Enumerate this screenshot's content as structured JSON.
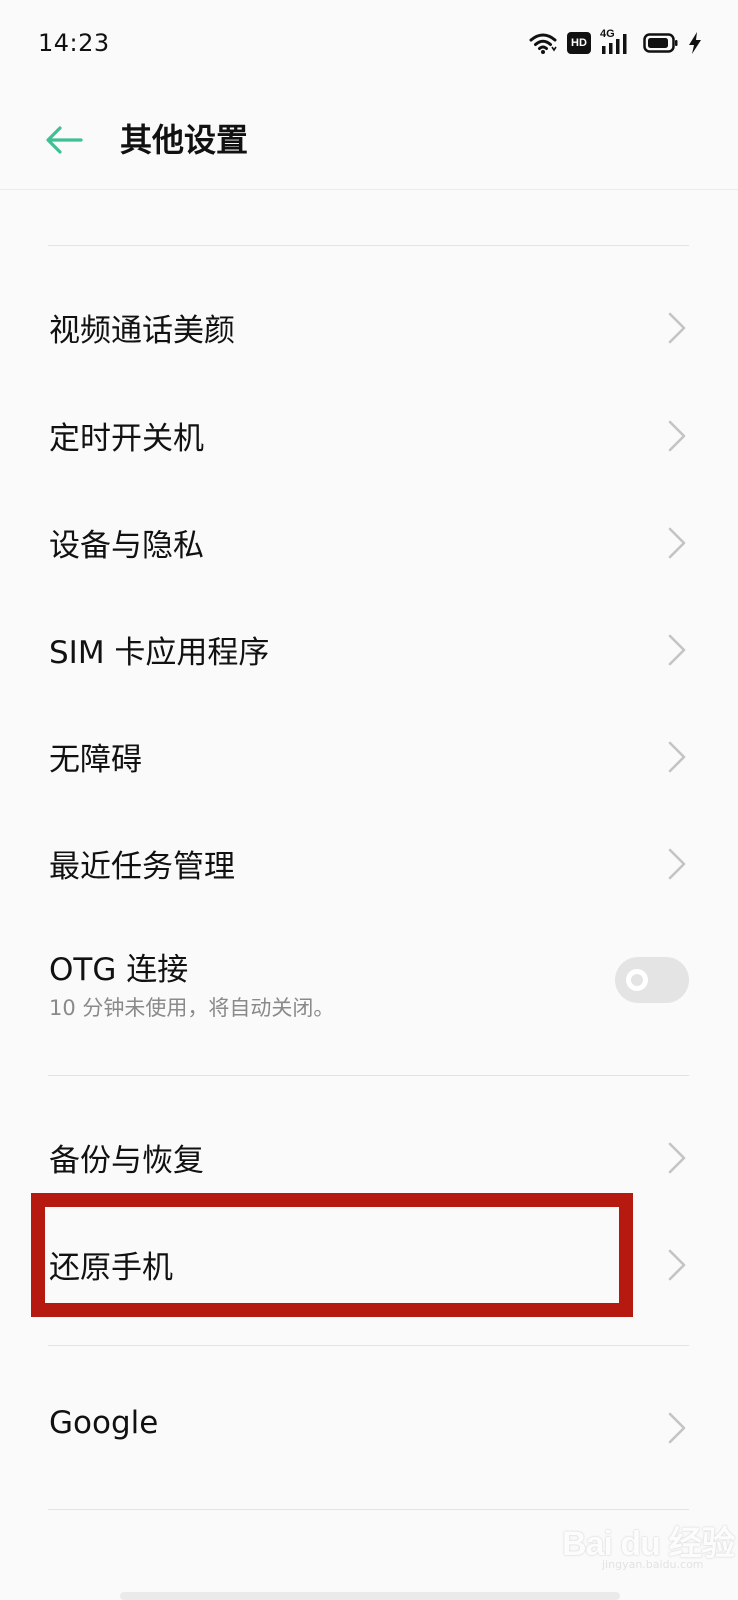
{
  "status_bar": {
    "time": "14:23",
    "network_label": "4G",
    "hd_label": "HD",
    "icons": [
      "wifi-icon",
      "hd-icon",
      "signal-icon",
      "battery-icon",
      "charging-icon"
    ]
  },
  "header": {
    "title": "其他设置",
    "back_icon": "arrow-left-icon",
    "accent_color": "#3fbf93"
  },
  "items": [
    {
      "label": "视频通话美颜",
      "type": "chevron"
    },
    {
      "label": "定时开关机",
      "type": "chevron"
    },
    {
      "label": "设备与隐私",
      "type": "chevron"
    },
    {
      "label": "SIM 卡应用程序",
      "type": "chevron"
    },
    {
      "label": "无障碍",
      "type": "chevron"
    },
    {
      "label": "最近任务管理",
      "type": "chevron"
    },
    {
      "label": "OTG 连接",
      "subtitle": "10 分钟未使用，将自动关闭。",
      "type": "toggle",
      "enabled": false
    },
    {
      "label": "备份与恢复",
      "type": "chevron"
    },
    {
      "label": "还原手机",
      "type": "chevron",
      "highlighted": true
    },
    {
      "label": "Google",
      "type": "chevron"
    }
  ],
  "highlight_color": "#b51910",
  "watermark": {
    "text": "Bai du 经验",
    "sub": "jingyan.baidu.com"
  }
}
